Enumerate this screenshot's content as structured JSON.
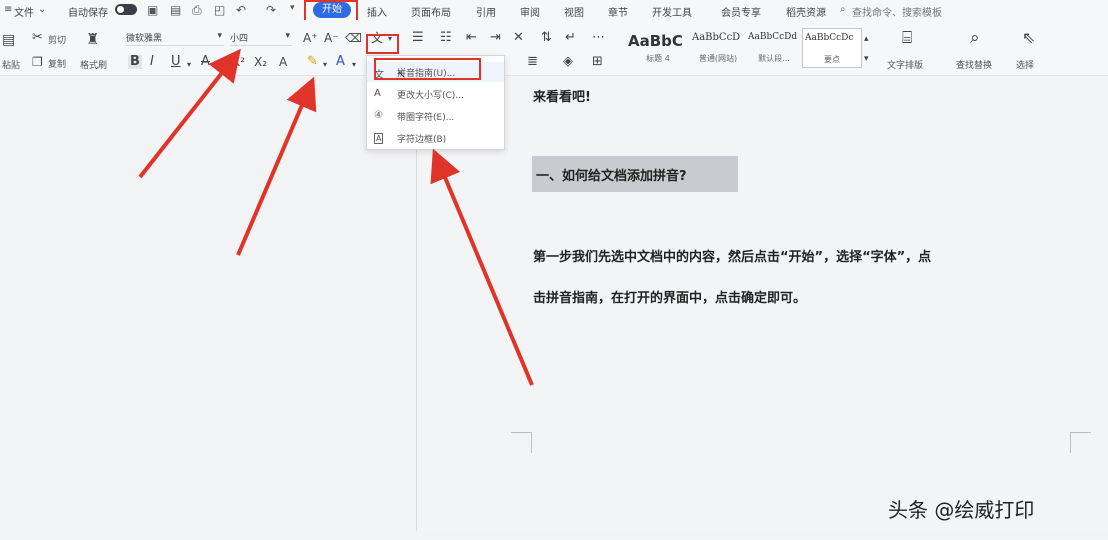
{
  "menu": {
    "file": "文件",
    "autosave": "自动保存",
    "tabs": [
      "开始",
      "插入",
      "页面布局",
      "引用",
      "审阅",
      "视图",
      "章节",
      "开发工具",
      "会员专享",
      "稻壳资源"
    ],
    "search": "查找命令、搜索模板"
  },
  "ribbon": {
    "cut": "剪切",
    "paste": "粘贴",
    "copy": "复制",
    "format_painter": "格式刷",
    "font_name": "微软雅黑",
    "font_size": "小四",
    "styles": [
      {
        "sample": "AaBbC",
        "caption": "标题 4"
      },
      {
        "sample": "AaBbCcD",
        "caption": "普通(网站)"
      },
      {
        "sample": "AaBbCcDd",
        "caption": "默认段..."
      },
      {
        "sample": "AaBbCcDc",
        "caption": "要点"
      }
    ],
    "text_layout": "文字排版",
    "find_replace": "查找替换",
    "select": "选择"
  },
  "dropdown": {
    "items": [
      {
        "icon": "文",
        "label": "拼音指南(U)..."
      },
      {
        "icon": "A",
        "label": "更改大小写(C)..."
      },
      {
        "icon": "④",
        "label": "带圈字符(E)..."
      },
      {
        "icon": "A",
        "label": "字符边框(B)"
      }
    ]
  },
  "document": {
    "line1": "来看看吧!",
    "heading": "一、如何给文档添加拼音?",
    "para1": "第一步我们先选中文档中的内容，然后点击“开始”，选择“字体”，点",
    "para2": "击拼音指南，在打开的界面中，点击确定即可。"
  },
  "watermark": "头条 @绘威打印",
  "colors": {
    "accent": "#2f6be3",
    "annotation": "#e0342a"
  }
}
